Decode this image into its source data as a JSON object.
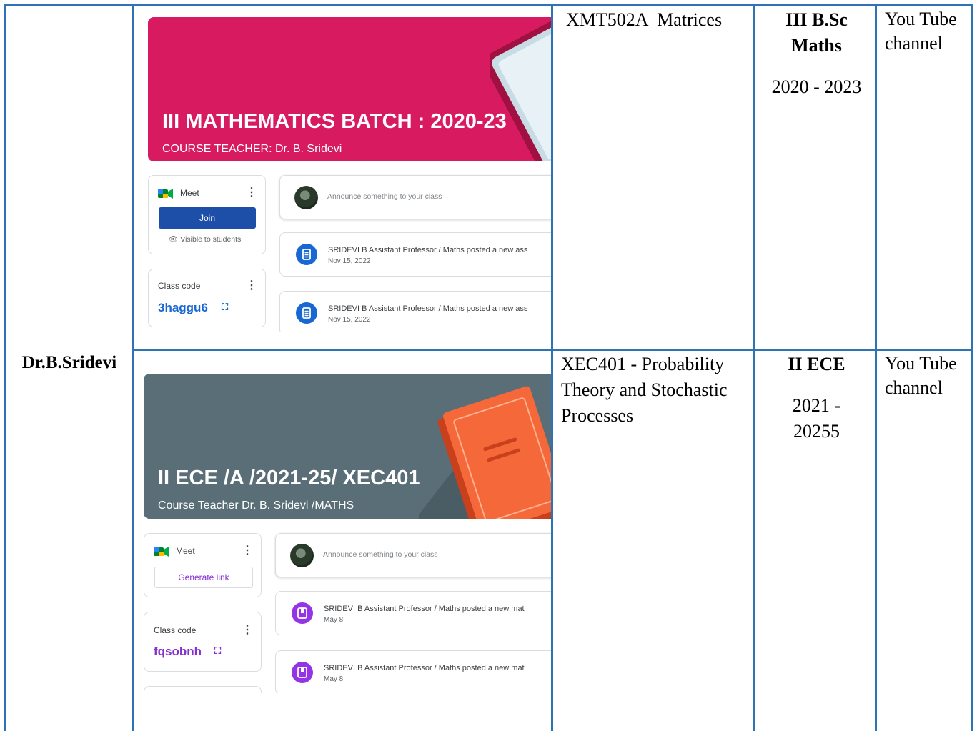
{
  "table": {
    "teacher": "Dr.B.Sridevi",
    "rows": [
      {
        "course": "XMT502A  Matrices",
        "class_name": "III B.Sc Maths",
        "years": "2020 - 2023",
        "link": "You Tube channel"
      },
      {
        "course": "XEC401 - Probability Theory and Stochastic Processes",
        "class_name": "II ECE",
        "years": "2021 - 20255",
        "link": "You Tube channel"
      }
    ]
  },
  "classrooms": [
    {
      "banner_title": "III MATHEMATICS BATCH : 2020-23",
      "banner_subtitle": "COURSE TEACHER: Dr. B. Sridevi",
      "banner_color": "#d81b60",
      "meet_label": "Meet",
      "meet_button": "Join",
      "visibility": "Visible to students",
      "class_code_label": "Class code",
      "class_code": "3haggu6",
      "code_color": "#1967d2",
      "announce_placeholder": "Announce something to your class",
      "posts": [
        {
          "text": "SRIDEVI B Assistant Professor / Maths posted a new ass",
          "date": "Nov 15, 2022",
          "icon": "assignment-icon"
        },
        {
          "text": "SRIDEVI B Assistant Professor / Maths posted a new ass",
          "date": "Nov 15, 2022",
          "icon": "assignment-icon"
        }
      ]
    },
    {
      "banner_title": "II ECE /A /2021-25/ XEC401",
      "banner_subtitle": "Course Teacher Dr. B. Sridevi /MATHS",
      "banner_color": "#5a6e78",
      "meet_label": "Meet",
      "meet_button": "Generate link",
      "class_code_label": "Class code",
      "class_code": "fqsobnh",
      "code_color": "#8430ce",
      "announce_placeholder": "Announce something to your class",
      "posts": [
        {
          "text": "SRIDEVI B Assistant Professor / Maths posted a new mat",
          "date": "May 8",
          "icon": "material-icon"
        },
        {
          "text": "SRIDEVI B Assistant Professor / Maths posted a new mat",
          "date": "May 8",
          "icon": "material-icon"
        }
      ]
    }
  ]
}
